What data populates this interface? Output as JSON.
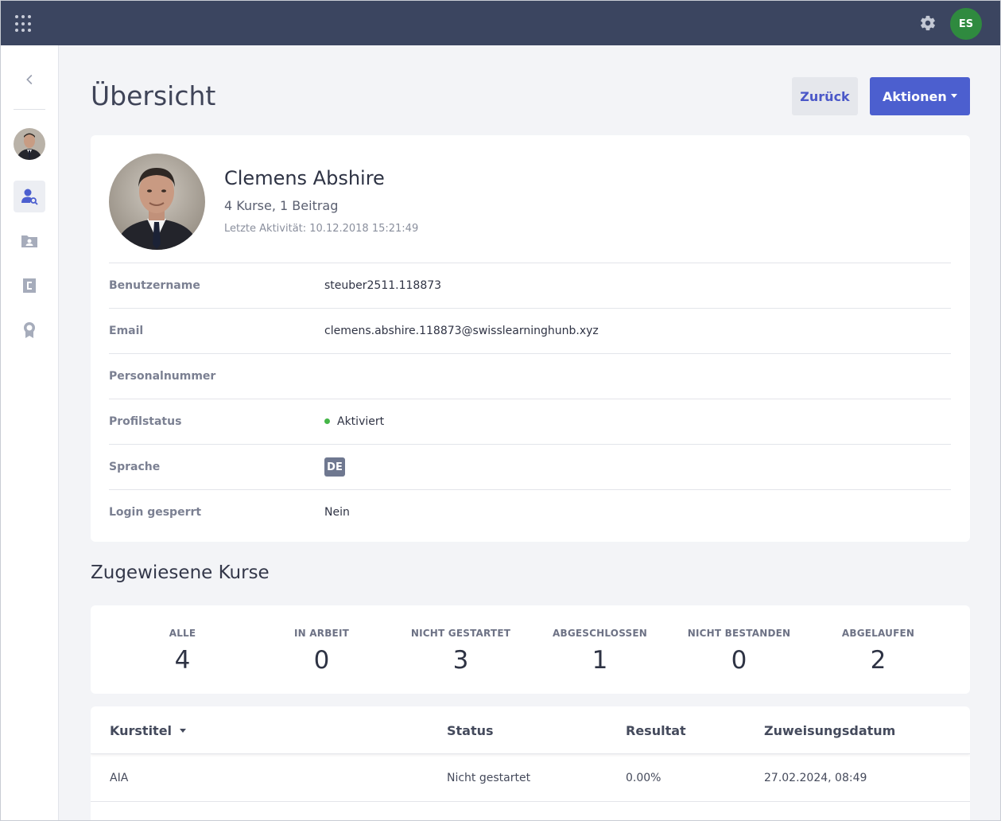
{
  "topbar": {
    "apps_icon": "grid-icon",
    "settings_icon": "gear-icon",
    "user_initials": "ES",
    "avatar_color": "#2f8a3f"
  },
  "sidebar": {
    "items": [
      {
        "name": "user-search",
        "icon": "user-search-icon",
        "active": true
      },
      {
        "name": "user-folder",
        "icon": "user-folder-icon",
        "active": false
      },
      {
        "name": "courses",
        "icon": "course-icon",
        "active": false
      },
      {
        "name": "certificates",
        "icon": "award-icon",
        "active": false
      }
    ]
  },
  "header": {
    "title": "Übersicht",
    "back_label": "Zurück",
    "actions_label": "Aktionen"
  },
  "profile": {
    "name": "Clemens Abshire",
    "summary": "4 Kurse, 1 Beitrag",
    "last_activity": "Letzte Aktivität: 10.12.2018 15:21:49",
    "fields": {
      "username": {
        "label": "Benutzername",
        "value": "steuber2511.118873"
      },
      "email": {
        "label": "Email",
        "value": "clemens.abshire.118873@swisslearninghunb.xyz"
      },
      "personnel": {
        "label": "Personalnummer",
        "value": ""
      },
      "status": {
        "label": "Profilstatus",
        "value": "Aktiviert",
        "color": "#45b648"
      },
      "language": {
        "label": "Sprache",
        "value": "DE"
      },
      "locked": {
        "label": "Login gesperrt",
        "value": "Nein"
      }
    }
  },
  "courses": {
    "section_title": "Zugewiesene Kurse",
    "stats": [
      {
        "label": "ALLE",
        "value": "4"
      },
      {
        "label": "IN ARBEIT",
        "value": "0"
      },
      {
        "label": "NICHT GESTARTET",
        "value": "3"
      },
      {
        "label": "ABGESCHLOSSEN",
        "value": "1"
      },
      {
        "label": "NICHT BESTANDEN",
        "value": "0"
      },
      {
        "label": "ABGELAUFEN",
        "value": "2"
      }
    ],
    "table": {
      "headers": {
        "title": "Kurstitel",
        "status": "Status",
        "result": "Resultat",
        "date": "Zuweisungsdatum"
      },
      "rows": [
        {
          "title": "AIA",
          "status": "Nicht gestartet",
          "result": "0.00%",
          "date": "27.02.2024, 08:49"
        }
      ]
    }
  },
  "colors": {
    "topbar": "#3b4560",
    "primary": "#4c5fcf",
    "background": "#f3f4f7"
  }
}
